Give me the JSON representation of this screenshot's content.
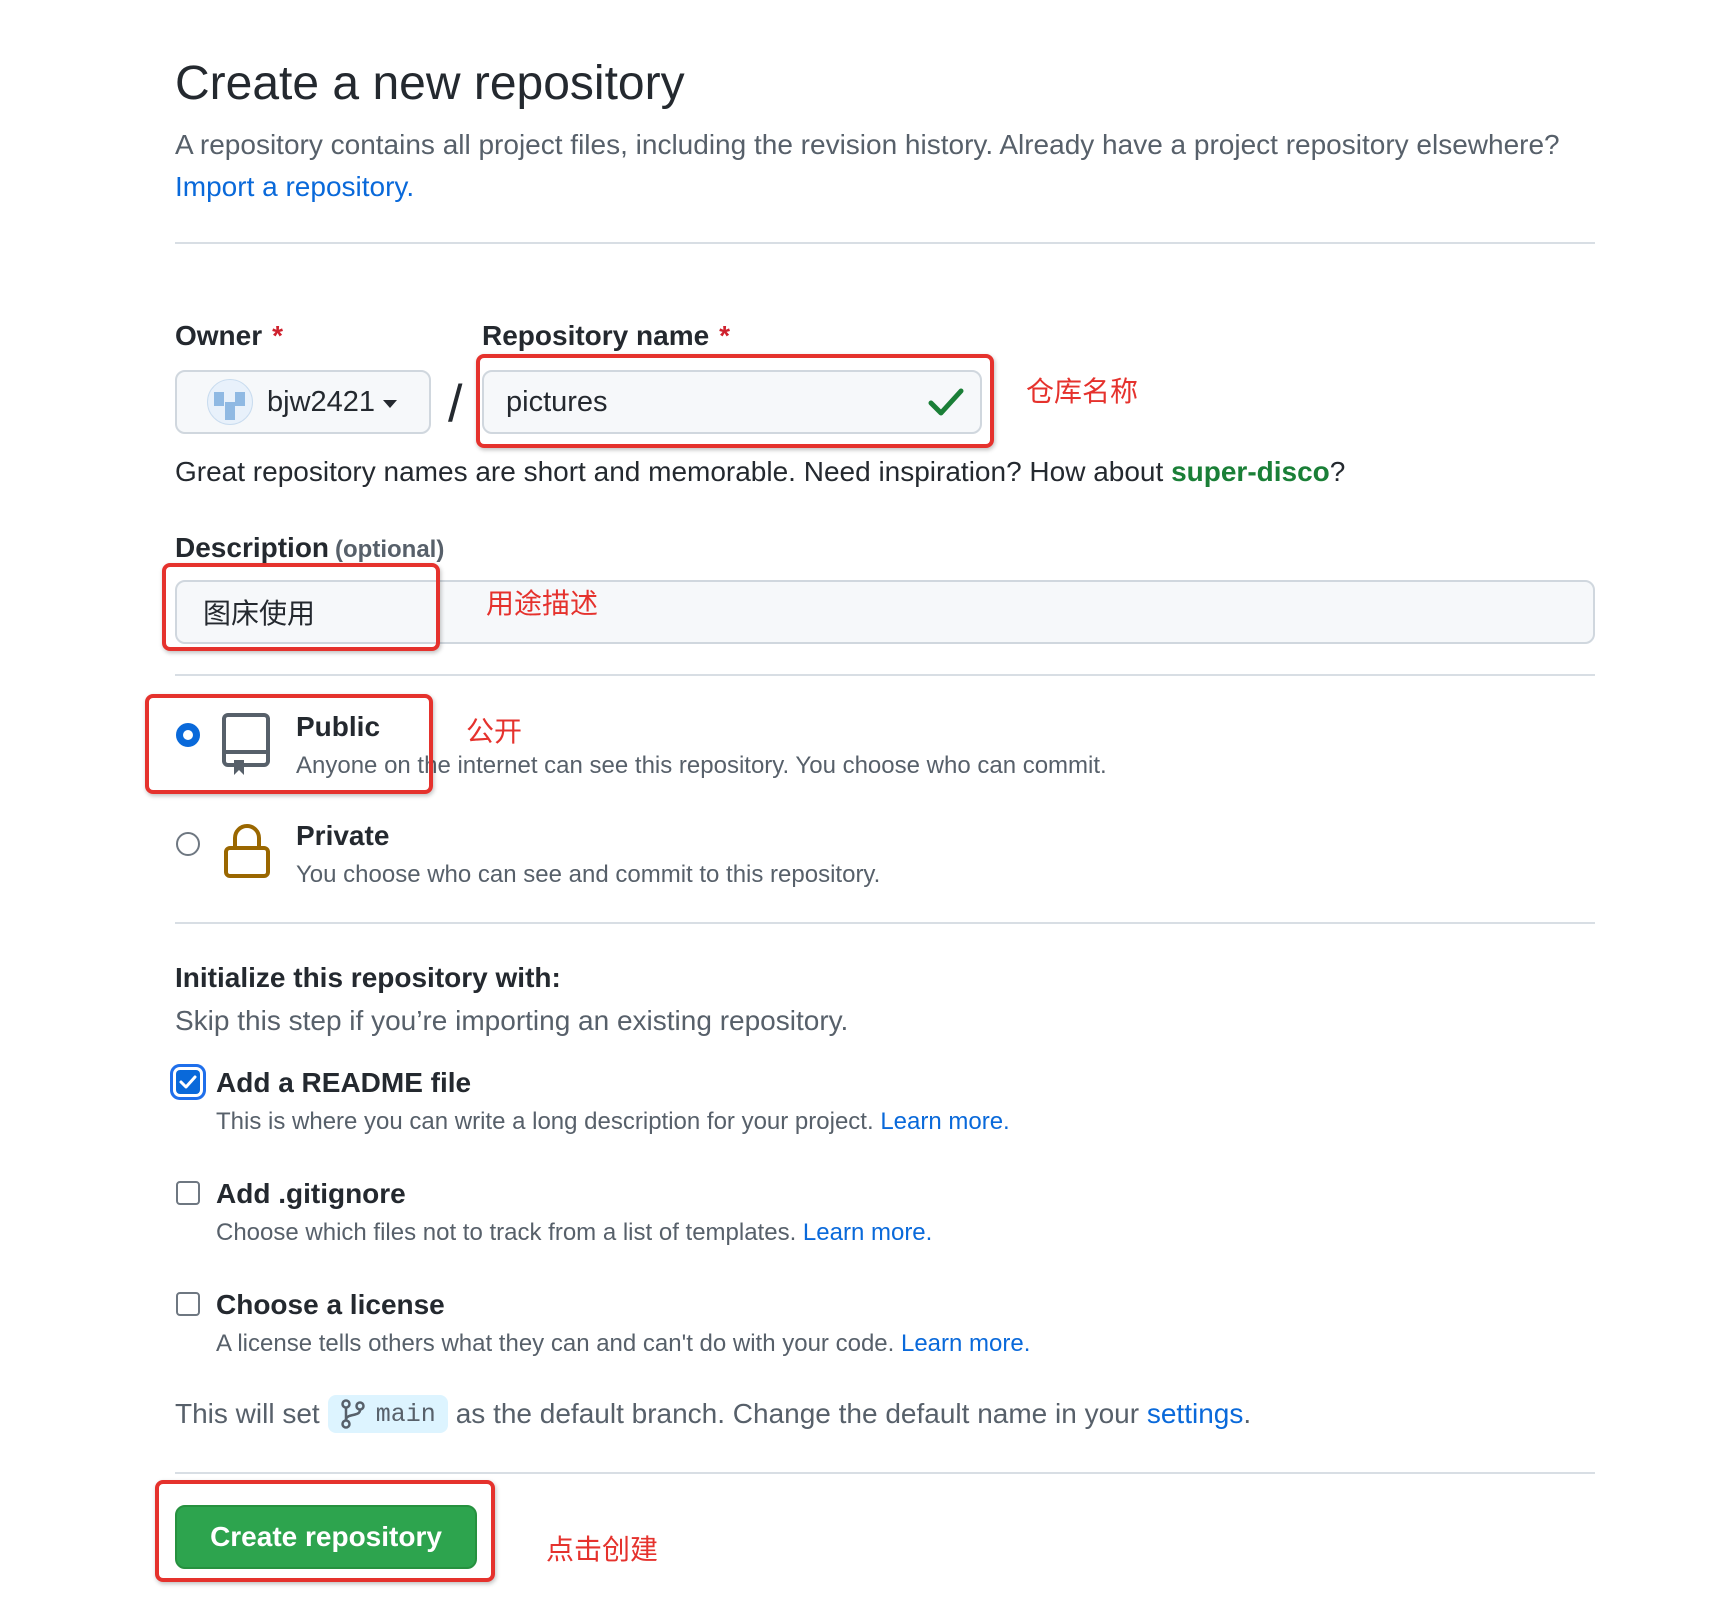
{
  "page": {
    "title": "Create a new repository",
    "intro": "A repository contains all project files, including the revision history. Already have a project repository elsewhere?",
    "import_link": "Import a repository."
  },
  "form": {
    "owner_label": "Owner",
    "required_mark": "*",
    "owner_value": "bjw2421",
    "separator": "/",
    "repo_name_label": "Repository name",
    "repo_name_value": "pictures",
    "name_hint_prefix": "Great repository names are short and memorable. Need inspiration? How about",
    "name_suggestion": "super-disco",
    "name_hint_suffix": "?",
    "description_label": "Description",
    "description_optional": "(optional)",
    "description_value": "图床使用"
  },
  "visibility": {
    "selected": "Public",
    "options": [
      {
        "title": "Public",
        "description": "Anyone on the internet can see this repository. You choose who can commit.",
        "icon": "repo-icon"
      },
      {
        "title": "Private",
        "description": "You choose who can see and commit to this repository.",
        "icon": "lock-icon"
      }
    ]
  },
  "initialize": {
    "heading": "Initialize this repository with:",
    "subheading": "Skip this step if you’re importing an existing repository.",
    "options": [
      {
        "title": "Add a README file",
        "description": "This is where you can write a long description for your project.",
        "link": "Learn more.",
        "checked": true
      },
      {
        "title": "Add .gitignore",
        "description": "Choose which files not to track from a list of templates.",
        "link": "Learn more.",
        "checked": false
      },
      {
        "title": "Choose a license",
        "description": "A license tells others what they can and can't do with your code.",
        "link": "Learn more.",
        "checked": false
      }
    ]
  },
  "branch": {
    "prefix": "This will set",
    "name": "main",
    "middle": "as the default branch. Change the default name in your",
    "settings_link": "settings",
    "suffix": "."
  },
  "submit": {
    "label": "Create repository"
  },
  "annotations": {
    "repo_name": "仓库名称",
    "description": "用途描述",
    "public": "公开",
    "create": "点击创建"
  },
  "colors": {
    "link": "#0969da",
    "success": "#2da44e",
    "annotation": "#e5322d",
    "private_lock": "#9a6700"
  }
}
